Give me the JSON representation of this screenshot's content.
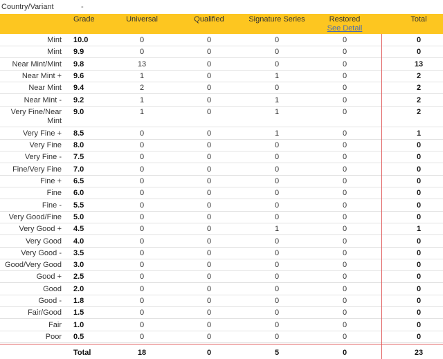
{
  "top": {
    "label": "Country/Variant",
    "value": "-"
  },
  "header": {
    "grade": "Grade",
    "universal": "Universal",
    "qualified": "Qualified",
    "signature": "Signature Series",
    "restored": "Restored",
    "see_detail": "See Detail",
    "total": "Total"
  },
  "rows": [
    {
      "label": "Mint",
      "grade": "10.0",
      "universal": "0",
      "qualified": "0",
      "signature": "0",
      "restored": "0",
      "total": "0"
    },
    {
      "label": "Mint",
      "grade": "9.9",
      "universal": "0",
      "qualified": "0",
      "signature": "0",
      "restored": "0",
      "total": "0"
    },
    {
      "label": "Near Mint/Mint",
      "grade": "9.8",
      "universal": "13",
      "qualified": "0",
      "signature": "0",
      "restored": "0",
      "total": "13"
    },
    {
      "label": "Near Mint +",
      "grade": "9.6",
      "universal": "1",
      "qualified": "0",
      "signature": "1",
      "restored": "0",
      "total": "2"
    },
    {
      "label": "Near Mint",
      "grade": "9.4",
      "universal": "2",
      "qualified": "0",
      "signature": "0",
      "restored": "0",
      "total": "2"
    },
    {
      "label": "Near Mint -",
      "grade": "9.2",
      "universal": "1",
      "qualified": "0",
      "signature": "1",
      "restored": "0",
      "total": "2"
    },
    {
      "label": "Very Fine/Near Mint",
      "grade": "9.0",
      "universal": "1",
      "qualified": "0",
      "signature": "1",
      "restored": "0",
      "total": "2",
      "tall": true
    },
    {
      "label": "Very Fine +",
      "grade": "8.5",
      "universal": "0",
      "qualified": "0",
      "signature": "1",
      "restored": "0",
      "total": "1"
    },
    {
      "label": "Very Fine",
      "grade": "8.0",
      "universal": "0",
      "qualified": "0",
      "signature": "0",
      "restored": "0",
      "total": "0"
    },
    {
      "label": "Very Fine -",
      "grade": "7.5",
      "universal": "0",
      "qualified": "0",
      "signature": "0",
      "restored": "0",
      "total": "0"
    },
    {
      "label": "Fine/Very Fine",
      "grade": "7.0",
      "universal": "0",
      "qualified": "0",
      "signature": "0",
      "restored": "0",
      "total": "0"
    },
    {
      "label": "Fine +",
      "grade": "6.5",
      "universal": "0",
      "qualified": "0",
      "signature": "0",
      "restored": "0",
      "total": "0"
    },
    {
      "label": "Fine",
      "grade": "6.0",
      "universal": "0",
      "qualified": "0",
      "signature": "0",
      "restored": "0",
      "total": "0"
    },
    {
      "label": "Fine -",
      "grade": "5.5",
      "universal": "0",
      "qualified": "0",
      "signature": "0",
      "restored": "0",
      "total": "0"
    },
    {
      "label": "Very Good/Fine",
      "grade": "5.0",
      "universal": "0",
      "qualified": "0",
      "signature": "0",
      "restored": "0",
      "total": "0"
    },
    {
      "label": "Very Good +",
      "grade": "4.5",
      "universal": "0",
      "qualified": "0",
      "signature": "1",
      "restored": "0",
      "total": "1"
    },
    {
      "label": "Very Good",
      "grade": "4.0",
      "universal": "0",
      "qualified": "0",
      "signature": "0",
      "restored": "0",
      "total": "0"
    },
    {
      "label": "Very Good -",
      "grade": "3.5",
      "universal": "0",
      "qualified": "0",
      "signature": "0",
      "restored": "0",
      "total": "0"
    },
    {
      "label": "Good/Very Good",
      "grade": "3.0",
      "universal": "0",
      "qualified": "0",
      "signature": "0",
      "restored": "0",
      "total": "0"
    },
    {
      "label": "Good +",
      "grade": "2.5",
      "universal": "0",
      "qualified": "0",
      "signature": "0",
      "restored": "0",
      "total": "0"
    },
    {
      "label": "Good",
      "grade": "2.0",
      "universal": "0",
      "qualified": "0",
      "signature": "0",
      "restored": "0",
      "total": "0"
    },
    {
      "label": "Good -",
      "grade": "1.8",
      "universal": "0",
      "qualified": "0",
      "signature": "0",
      "restored": "0",
      "total": "0"
    },
    {
      "label": "Fair/Good",
      "grade": "1.5",
      "universal": "0",
      "qualified": "0",
      "signature": "0",
      "restored": "0",
      "total": "0"
    },
    {
      "label": "Fair",
      "grade": "1.0",
      "universal": "0",
      "qualified": "0",
      "signature": "0",
      "restored": "0",
      "total": "0"
    },
    {
      "label": "Poor",
      "grade": "0.5",
      "universal": "0",
      "qualified": "0",
      "signature": "0",
      "restored": "0",
      "total": "0"
    }
  ],
  "totals": {
    "label": "Total",
    "universal": "18",
    "qualified": "0",
    "signature": "5",
    "restored": "0",
    "total": "23"
  },
  "colors": {
    "header_bg": "#fdc620",
    "divider_red": "#e05a5a",
    "link": "#4a6cb3"
  }
}
